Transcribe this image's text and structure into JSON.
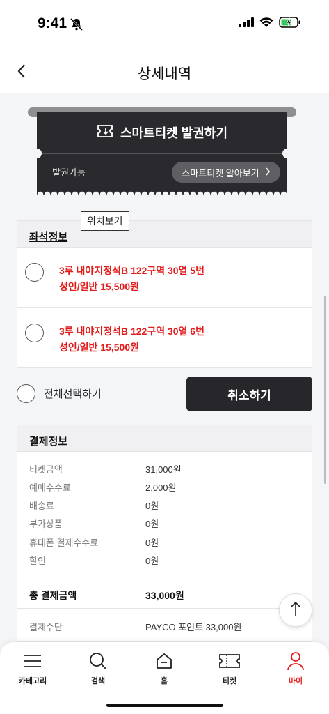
{
  "status_bar": {
    "time": "9:41"
  },
  "header": {
    "title": "상세내역"
  },
  "ticket": {
    "title": "스마트티켓 발권하기",
    "status": "발권가능",
    "learn_button": "스마트티켓 알아보기"
  },
  "seats": {
    "section_title": "좌석정보",
    "tooltip": "위치보기",
    "items": [
      {
        "line1": "3루 내야지정석B 122구역 30열 5번",
        "line2": "성인/일반 15,500원"
      },
      {
        "line1": "3루 내야지정석B 122구역 30열 6번",
        "line2": "성인/일반 15,500원"
      }
    ]
  },
  "actions": {
    "select_all": "전체선택하기",
    "cancel": "취소하기"
  },
  "payment": {
    "section_title": "결제정보",
    "rows": [
      {
        "label": "티켓금액",
        "value": "31,000원"
      },
      {
        "label": "예매수수료",
        "value": "2,000원"
      },
      {
        "label": "배송료",
        "value": "0원"
      },
      {
        "label": "부가상품",
        "value": "0원"
      },
      {
        "label": "휴대폰 결제수수료",
        "value": "0원"
      },
      {
        "label": "할인",
        "value": "0원"
      }
    ],
    "total_label": "총 결제금액",
    "total_value": "33,000원",
    "method_label": "결제수단",
    "method_value": "PAYCO 포인트 33,000원"
  },
  "nav": {
    "items": [
      {
        "label": "카테고리",
        "icon": "menu-icon"
      },
      {
        "label": "검색",
        "icon": "search-icon"
      },
      {
        "label": "홈",
        "icon": "home-icon"
      },
      {
        "label": "티켓",
        "icon": "ticket-icon"
      },
      {
        "label": "마이",
        "icon": "user-icon",
        "active": true
      }
    ]
  },
  "colors": {
    "accent": "#e21b1b",
    "dark": "#26262b"
  }
}
